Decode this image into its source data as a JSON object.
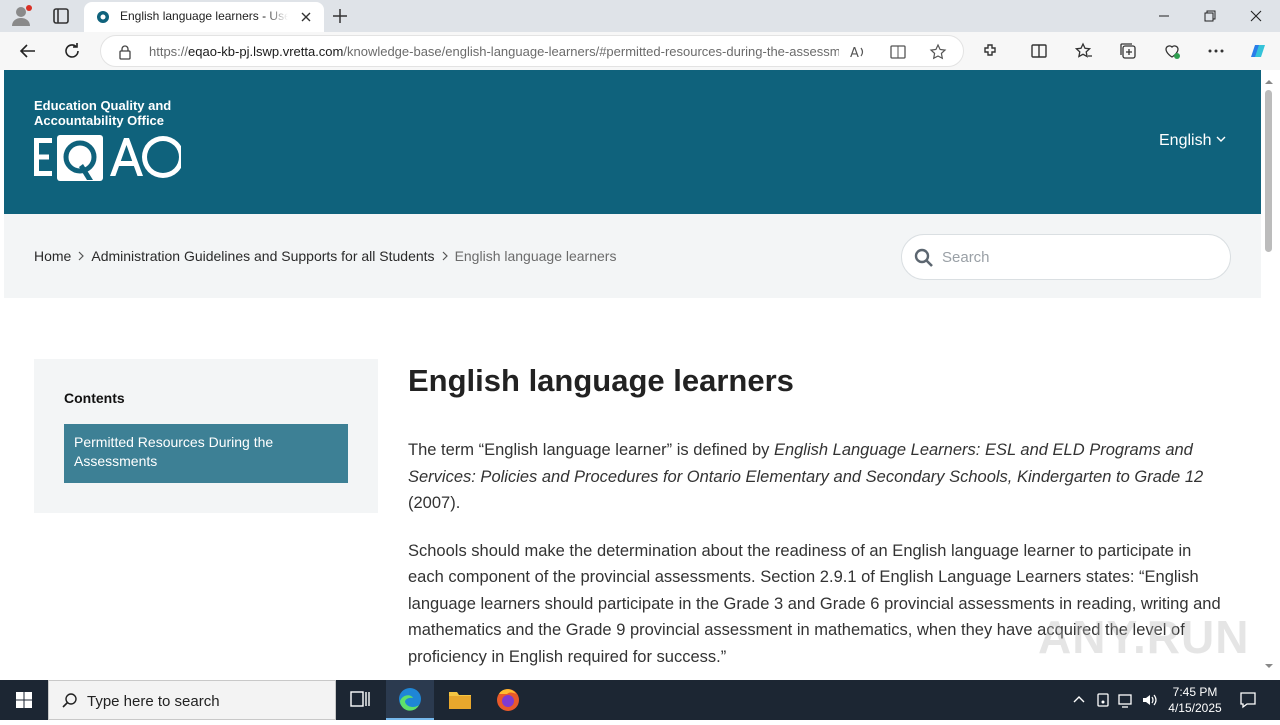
{
  "browser": {
    "tab_title": "English language learners - User Guide",
    "url_scheme": "https://",
    "url_host": "eqao-kb-pj.lswp.vretta.com",
    "url_path": "/knowledge-base/english-language-learners/#permitted-resources-during-the-assessments",
    "accent_color": "#0f627c"
  },
  "header": {
    "logo_tagline": "Education Quality and Accountability Office",
    "logo_text": "EQAO",
    "language_label": "English"
  },
  "breadcrumb": {
    "items": [
      "Home",
      "Administration Guidelines and Supports for all Students",
      "English language learners"
    ]
  },
  "search": {
    "placeholder": "Search"
  },
  "toc": {
    "title": "Contents",
    "items": [
      "Permitted Resources During the Assessments"
    ]
  },
  "article": {
    "title": "English language learners",
    "p1_a": "The term “English language learner” is defined by ",
    "p1_em": "English Language Learners: ESL and ELD Programs and Services: Policies and Procedures for Ontario Elementary and Secondary Schools, Kindergarten to Grade 12",
    "p1_b": " (2007).",
    "p2": "Schools should make the determination about the readiness of an English language learner to participate in each component of the provincial assessments. Section 2.9.1 of English Language Learners states: “English language learners should participate in the Grade 3 and Grade 6 provincial assessments in reading, writing and mathematics and the Grade 9 provincial assessment in mathematics, when they have acquired the level of proficiency in English required for success.”"
  },
  "watermark": "ANY.RUN",
  "taskbar": {
    "search_placeholder": "Type here to search",
    "time": "7:45 PM",
    "date": "4/15/2025"
  }
}
